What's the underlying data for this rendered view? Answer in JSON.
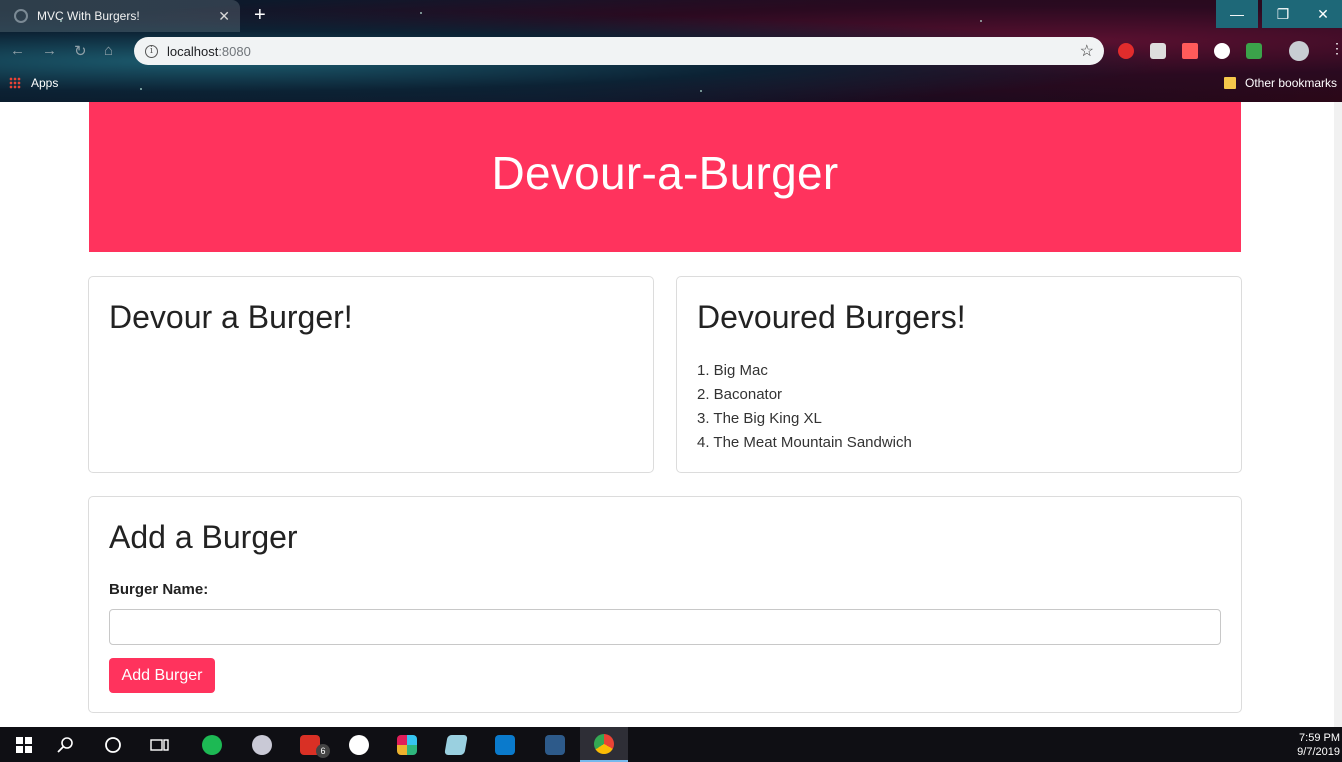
{
  "browser": {
    "tab_title": "MVC With Burgers!",
    "tab_close": "✕",
    "new_tab": "+",
    "url_host": "localhost",
    "url_port": ":8080",
    "bookmarks": {
      "apps_label": "Apps",
      "other_label": "Other bookmarks"
    },
    "window_controls": {
      "minimize": "—",
      "maximize": "❐",
      "close": "✕"
    }
  },
  "page": {
    "header_title": "Devour-a-Burger",
    "devour_card": {
      "title": "Devour a Burger!"
    },
    "devoured_card": {
      "title": "Devoured Burgers!",
      "items": [
        "1. Big Mac",
        "2. Baconator",
        "3. The Big King XL",
        "4. The Meat Mountain Sandwich"
      ]
    },
    "add_card": {
      "title": "Add a Burger",
      "label": "Burger Name:",
      "input_value": "",
      "button_label": "Add Burger"
    }
  },
  "taskbar": {
    "time": "7:59 PM",
    "date": "9/7/2019",
    "gmail_badge": "6",
    "apps": [
      "start-icon",
      "search-icon",
      "cortana-icon",
      "task-view-icon",
      "spotify-icon",
      "app-icon",
      "gmail-icon",
      "github-icon",
      "slack-icon",
      "notes-icon",
      "vscode-icon",
      "mysql-workbench-icon",
      "chrome-icon"
    ]
  },
  "colors": {
    "brand": "#ff335d",
    "taskbar": "#0f0f14",
    "card_border": "#dcdcdc"
  }
}
